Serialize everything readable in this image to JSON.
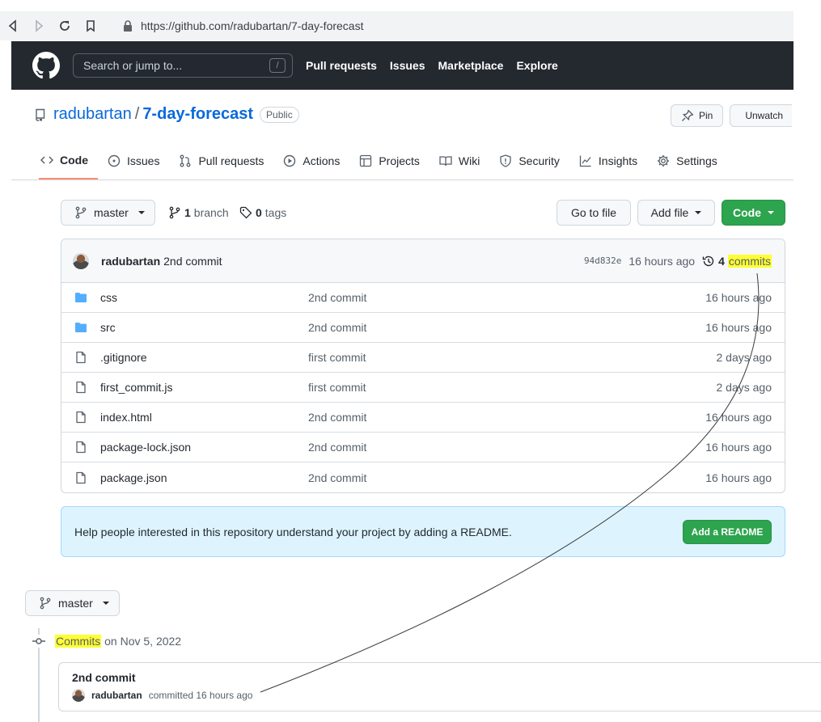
{
  "browser": {
    "url": "https://github.com/radubartan/7-day-forecast"
  },
  "header": {
    "search_placeholder": "Search or jump to...",
    "search_shortcut": "/",
    "nav": [
      "Pull requests",
      "Issues",
      "Marketplace",
      "Explore"
    ]
  },
  "repo": {
    "owner": "radubartan",
    "separator": "/",
    "name": "7-day-forecast",
    "visibility": "Public",
    "pin_label": "Pin",
    "unwatch_label": "Unwatch"
  },
  "tabs": [
    {
      "label": "Code",
      "icon": "code-icon"
    },
    {
      "label": "Issues",
      "icon": "issue-icon"
    },
    {
      "label": "Pull requests",
      "icon": "pull-request-icon"
    },
    {
      "label": "Actions",
      "icon": "play-icon"
    },
    {
      "label": "Projects",
      "icon": "table-icon"
    },
    {
      "label": "Wiki",
      "icon": "book-icon"
    },
    {
      "label": "Security",
      "icon": "shield-icon"
    },
    {
      "label": "Insights",
      "icon": "graph-icon"
    },
    {
      "label": "Settings",
      "icon": "gear-icon"
    }
  ],
  "toolbar": {
    "branch": "master",
    "branch_count": "1",
    "branch_label": "branch",
    "tag_count": "0",
    "tag_label": "tags",
    "go_to_file": "Go to file",
    "add_file": "Add file",
    "code": "Code"
  },
  "latest_commit": {
    "author": "radubartan",
    "message": "2nd commit",
    "sha": "94d832e",
    "age": "16 hours ago",
    "count": "4",
    "count_label": "commits"
  },
  "files": [
    {
      "name": "css",
      "type": "folder",
      "commit": "2nd commit",
      "age": "16 hours ago"
    },
    {
      "name": "src",
      "type": "folder",
      "commit": "2nd commit",
      "age": "16 hours ago"
    },
    {
      "name": ".gitignore",
      "type": "file",
      "commit": "first commit",
      "age": "2 days ago"
    },
    {
      "name": "first_commit.js",
      "type": "file",
      "commit": "first commit",
      "age": "2 days ago"
    },
    {
      "name": "index.html",
      "type": "file",
      "commit": "2nd commit",
      "age": "16 hours ago"
    },
    {
      "name": "package-lock.json",
      "type": "file",
      "commit": "2nd commit",
      "age": "16 hours ago"
    },
    {
      "name": "package.json",
      "type": "file",
      "commit": "2nd commit",
      "age": "16 hours ago"
    }
  ],
  "readme_banner": {
    "text": "Help people interested in this repository understand your project by adding a README.",
    "button": "Add a README"
  },
  "commits_page": {
    "branch": "master",
    "heading_highlight": "Commits",
    "heading_rest": " on Nov 5, 2022",
    "commit_title": "2nd commit",
    "commit_author": "radubartan",
    "commit_meta": "committed 16 hours ago"
  },
  "colors": {
    "highlight": "#ffff33",
    "accent_link": "#0969da",
    "primary_button": "#2da44e",
    "header_bg": "#24292f",
    "tab_underline": "#fd8c73"
  }
}
